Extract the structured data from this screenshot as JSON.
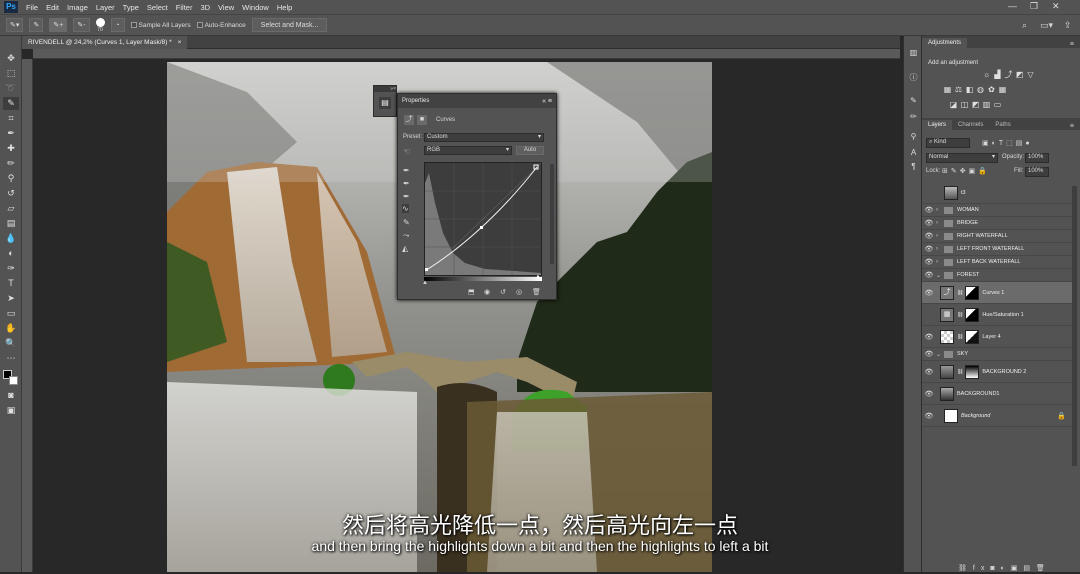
{
  "menu": {
    "items": [
      "File",
      "Edit",
      "Image",
      "Layer",
      "Type",
      "Select",
      "Filter",
      "3D",
      "View",
      "Window",
      "Help"
    ]
  },
  "options": {
    "brush_size": "70",
    "sample_all_layers": "Sample All Layers",
    "auto_enhance": "Auto-Enhance",
    "select_and_mask": "Select and Mask..."
  },
  "document": {
    "tab_title": "RIVENDELL @ 24,2% (Curves 1, Layer Mask/8) *",
    "close": "×"
  },
  "properties": {
    "title": "Properties",
    "panel_type": "Curves",
    "preset_label": "Preset:",
    "preset_value": "Custom",
    "channel": "RGB",
    "auto_button": "Auto"
  },
  "subtitles": {
    "chinese": "然后将高光降低一点，然后高光向左一点",
    "english": "and then bring the highlights down a bit and then the highlights to left a bit"
  },
  "adjustments": {
    "tab": "Adjustments",
    "add_label": "Add an adjustment"
  },
  "layers_panel": {
    "tabs": [
      "Layers",
      "Channels",
      "Paths"
    ],
    "kind_label": "Kind",
    "blend_mode": "Normal",
    "opacity_label": "Opacity:",
    "opacity_value": "100%",
    "lock_label": "Lock:",
    "fill_label": "Fill:",
    "fill_value": "100%",
    "layers": [
      {
        "name": "t3",
        "type": "layer"
      },
      {
        "name": "WOMAN",
        "type": "group"
      },
      {
        "name": "BRIDGE",
        "type": "group"
      },
      {
        "name": "RIGHT WATERFALL",
        "type": "group"
      },
      {
        "name": "LEFT FRONT WATERFALL",
        "type": "group"
      },
      {
        "name": "LEFT BACK WATERFALL",
        "type": "group"
      },
      {
        "name": "FOREST",
        "type": "group-open"
      },
      {
        "name": "Curves 1",
        "type": "adjustment",
        "selected": true
      },
      {
        "name": "Hue/Saturation 1",
        "type": "adjustment"
      },
      {
        "name": "Layer 4",
        "type": "layer"
      },
      {
        "name": "SKY",
        "type": "group-open"
      },
      {
        "name": "BACKGROUND 2",
        "type": "layer"
      },
      {
        "name": "BACKGROUND1",
        "type": "layer"
      },
      {
        "name": "Background",
        "type": "background"
      }
    ]
  },
  "colors": {
    "ui_bg": "#535353",
    "panel_dark": "#424242",
    "canvas_bg": "#282828",
    "selected_layer": "#6b6b6b"
  }
}
